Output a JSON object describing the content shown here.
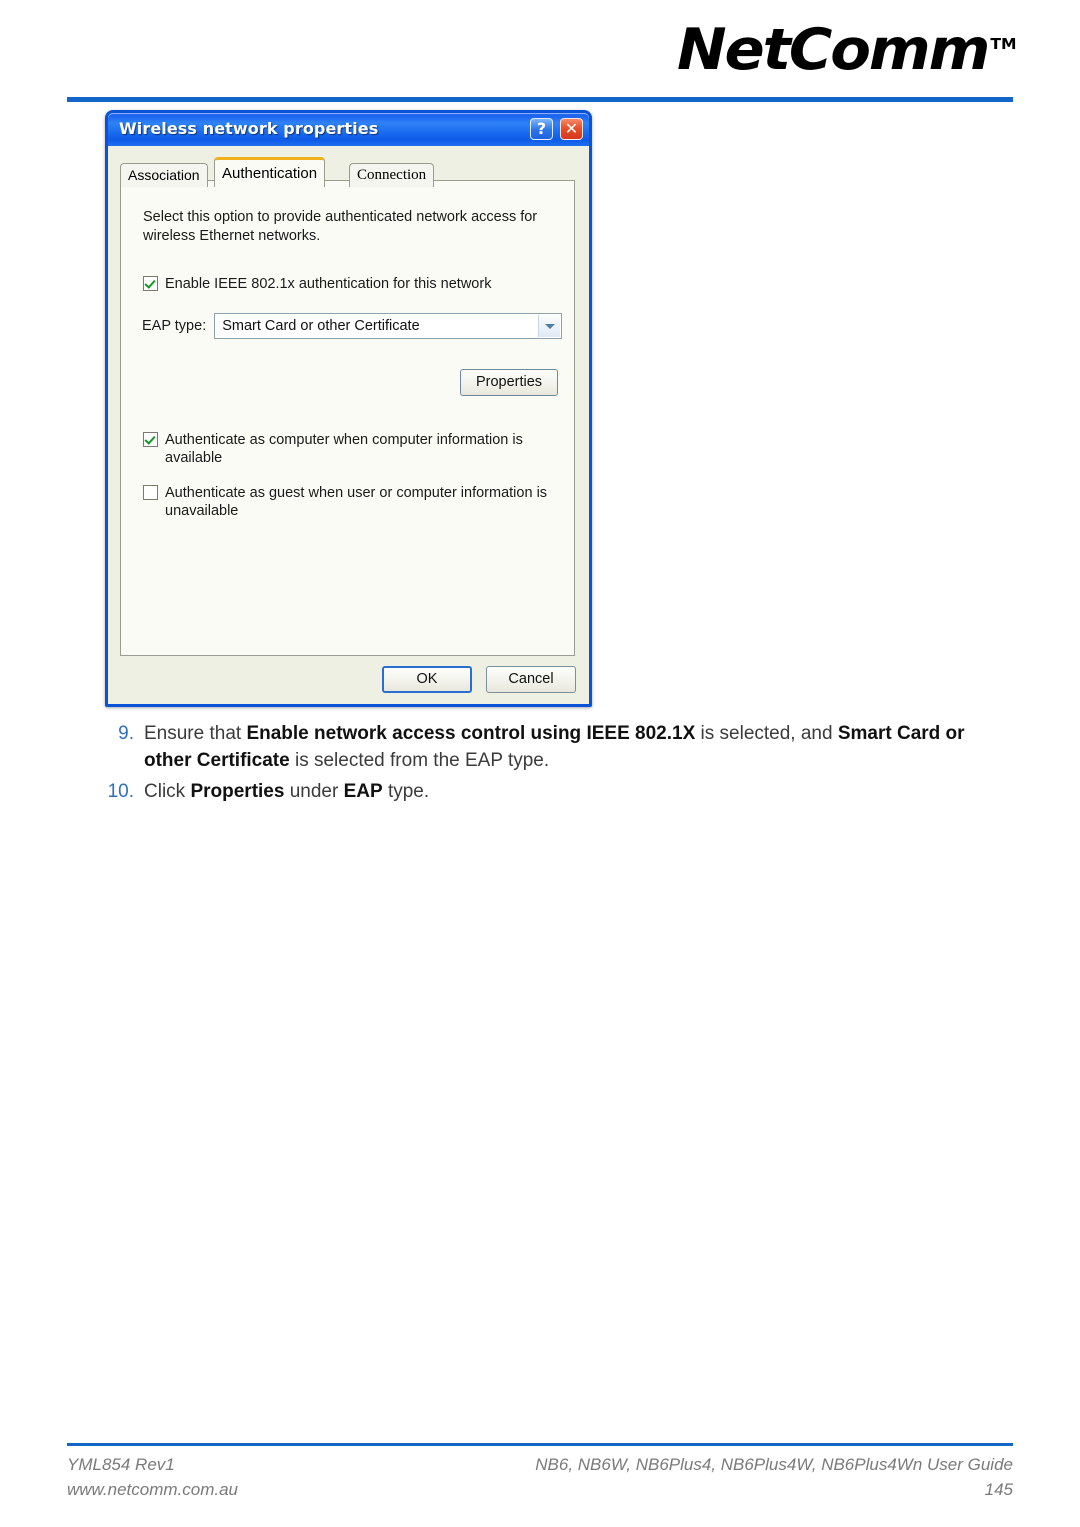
{
  "header": {
    "brand": "NetComm",
    "trademark": "TM"
  },
  "dialog": {
    "title": "Wireless network properties",
    "help_button": "?",
    "close_button": "✕",
    "tabs": [
      {
        "label": "Association",
        "active": false
      },
      {
        "label": "Authentication",
        "active": true
      },
      {
        "label": "Connection",
        "active": false
      }
    ],
    "panel": {
      "description": "Select this option to provide authenticated network access for wireless Ethernet networks.",
      "enable_8021x_label": "Enable IEEE 802.1x authentication for this network",
      "enable_8021x_checked": true,
      "eap_type_label": "EAP type:",
      "eap_type_value": "Smart Card or other Certificate",
      "properties_button": "Properties",
      "auth_computer_label": "Authenticate as computer when computer information is available",
      "auth_computer_checked": true,
      "auth_guest_label": "Authenticate as guest when user or computer information is unavailable",
      "auth_guest_checked": false
    },
    "ok_button": "OK",
    "cancel_button": "Cancel"
  },
  "steps": [
    {
      "number": "9.",
      "parts": [
        {
          "text": "Ensure that ",
          "bold": false
        },
        {
          "text": "Enable network access control using IEEE 802.1X",
          "bold": true
        },
        {
          "text": " is selected, and ",
          "bold": false
        },
        {
          "text": "Smart Card or other Certificate",
          "bold": true
        },
        {
          "text": " is selected from the EAP type.",
          "bold": false
        }
      ]
    },
    {
      "number": "10.",
      "parts": [
        {
          "text": "Click ",
          "bold": false
        },
        {
          "text": "Properties",
          "bold": true
        },
        {
          "text": " under ",
          "bold": false
        },
        {
          "text": "EAP",
          "bold": true
        },
        {
          "text": " type.",
          "bold": false
        }
      ]
    }
  ],
  "footer": {
    "doc_id": "YML854 Rev1",
    "url": "www.netcomm.com.au",
    "guide": "NB6, NB6W, NB6Plus4, NB6Plus4W, NB6Plus4Wn User Guide",
    "page": "145"
  },
  "colors": {
    "accent_blue": "#1465c8",
    "titlebar_blue": "#1b62ef",
    "tab_active_top": "#f0b019",
    "check_green": "#119a22",
    "step_number_blue": "#2f6fc0"
  }
}
